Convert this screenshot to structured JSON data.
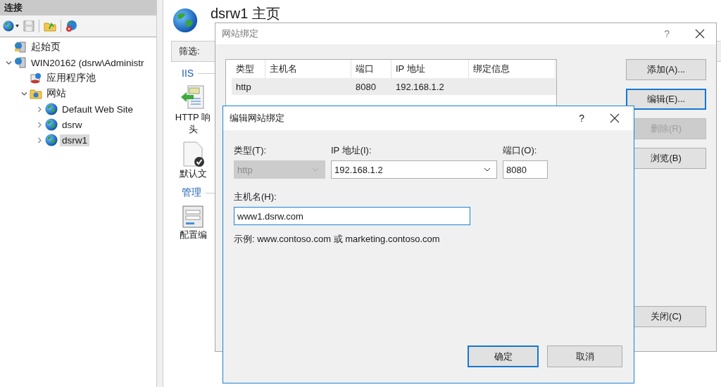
{
  "connections": {
    "title": "连接",
    "tree": [
      {
        "label": "起始页",
        "kind": "start_page",
        "selected": false
      },
      {
        "label": "WIN20162 (dsrw\\Administr",
        "kind": "server",
        "expanded": true,
        "selected": false,
        "children": [
          {
            "label": "应用程序池",
            "kind": "app_pools",
            "selected": false
          },
          {
            "label": "网站",
            "kind": "sites_folder",
            "expanded": true,
            "selected": false,
            "children": [
              {
                "label": "Default Web Site",
                "kind": "site",
                "expanded": false,
                "selected": false
              },
              {
                "label": "dsrw",
                "kind": "site",
                "expanded": false,
                "selected": false
              },
              {
                "label": "dsrw1",
                "kind": "site",
                "expanded": false,
                "selected": true
              }
            ]
          }
        ]
      }
    ]
  },
  "main": {
    "title": "dsrw1 主页",
    "filter_label": "筛选:",
    "groups": [
      {
        "title": "IIS",
        "features": [
          {
            "kind": "http_headers",
            "lines": [
              "HTTP 响",
              "头"
            ]
          },
          {
            "kind": "default_document",
            "lines": [
              "默认文"
            ]
          }
        ]
      },
      {
        "title": "管理",
        "features": [
          {
            "kind": "config_editor",
            "lines": [
              "配置编"
            ]
          }
        ]
      }
    ]
  },
  "bindings_dialog": {
    "title": "网站绑定",
    "help": "?",
    "columns": [
      "类型",
      "主机名",
      "端口",
      "IP 地址",
      "绑定信息"
    ],
    "rows": [
      {
        "type": "http",
        "port": "8080",
        "ip_address": "192.168.1.2",
        "selected": true
      }
    ],
    "buttons": [
      {
        "label": "添加(A)...",
        "disabled": false,
        "focused": false
      },
      {
        "label": "编辑(E)...",
        "disabled": false,
        "focused": true
      },
      {
        "label": "删除(R)",
        "disabled": true,
        "focused": false
      },
      {
        "label": "浏览(B)",
        "disabled": false,
        "focused": false
      }
    ],
    "close_button": "关闭(C)"
  },
  "edit_dialog": {
    "title": "编辑网站绑定",
    "help": "?",
    "type_field": {
      "label": "类型(T):",
      "value": "http",
      "disabled": true
    },
    "ip_field": {
      "label": "IP 地址(I):",
      "value": "192.168.1.2"
    },
    "port_field": {
      "label": "端口(O):",
      "value": "8080"
    },
    "host_field": {
      "label": "主机名(H):",
      "value": "www1.dsrw.com"
    },
    "example": "示例: www.contoso.com 或 marketing.contoso.com",
    "buttons": [
      {
        "label": "确定",
        "default": true
      },
      {
        "label": "取消",
        "default": false
      }
    ]
  }
}
